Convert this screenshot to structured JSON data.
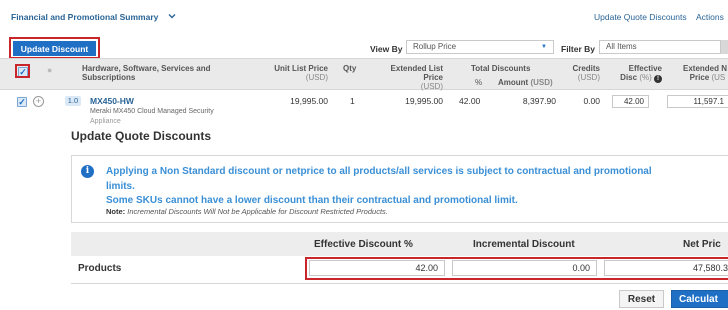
{
  "header": {
    "summary_title": "Financial and Promotional Summary",
    "link_update_quote_discounts": "Update Quote Discounts",
    "link_actions": "Actions"
  },
  "toolbar": {
    "update_discount_label": "Update Discount",
    "view_by_label": "View By",
    "view_by_value": "Rollup Price",
    "filter_by_label": "Filter By",
    "filter_by_value": "All Items"
  },
  "table": {
    "columns": {
      "product": "Hardware, Software, Services and Subscriptions",
      "unit_list_price": "Unit List Price",
      "unit_list_price_unit": "(USD)",
      "qty": "Qty",
      "extended_list_price": "Extended List Price",
      "extended_list_price_unit": "(USD)",
      "total_discounts": "Total Discounts",
      "total_discounts_pct": "%",
      "total_discounts_amount": "Amount",
      "total_discounts_amount_unit": "(USD)",
      "credits": "Credits",
      "credits_unit": "(USD)",
      "effective_disc": "Effective",
      "effective_disc_2": "Disc",
      "effective_disc_unit": "(%)",
      "extended_net_price": "Extended N",
      "extended_net_price_2": "Price",
      "extended_net_price_unit": "(US"
    },
    "rows": [
      {
        "line_number": "1.0",
        "sku": "MX450-HW",
        "description_1": "Meraki MX450 Cloud Managed Security",
        "description_2": "Appliance",
        "unit_list_price": "19,995.00",
        "qty": "1",
        "extended_list_price": "19,995.00",
        "discount_pct": "42.00",
        "discount_amount": "8,397.90",
        "credits": "0.00",
        "effective_disc": "42.00",
        "extended_net_price": "11,597.1"
      }
    ]
  },
  "update_quote_discounts": {
    "title": "Update Quote Discounts",
    "info_line_1": "Applying a Non Standard discount or netprice to all products/all services is subject to contractual and promotional",
    "info_line_2": "limits.",
    "info_line_3": "Some SKUs cannot have a lower discount than their contractual and promotional limit.",
    "note_label": "Note:",
    "note_text": "Incremental Discounts Will Not be Applicable for Discount Restricted Products.",
    "columns": {
      "effective_discount": "Effective Discount %",
      "incremental_discount": "Incremental Discount",
      "net_price": "Net Pric"
    },
    "products_row": {
      "label": "Products",
      "effective_discount": "42.00",
      "incremental_discount": "0.00",
      "net_price": "47,580.3"
    },
    "reset_label": "Reset",
    "calculate_label": "Calculat"
  },
  "colors": {
    "primary": "#1f6fc5",
    "link": "#2a6496",
    "info_text": "#3a8fd6",
    "highlight": "#c9262c"
  }
}
